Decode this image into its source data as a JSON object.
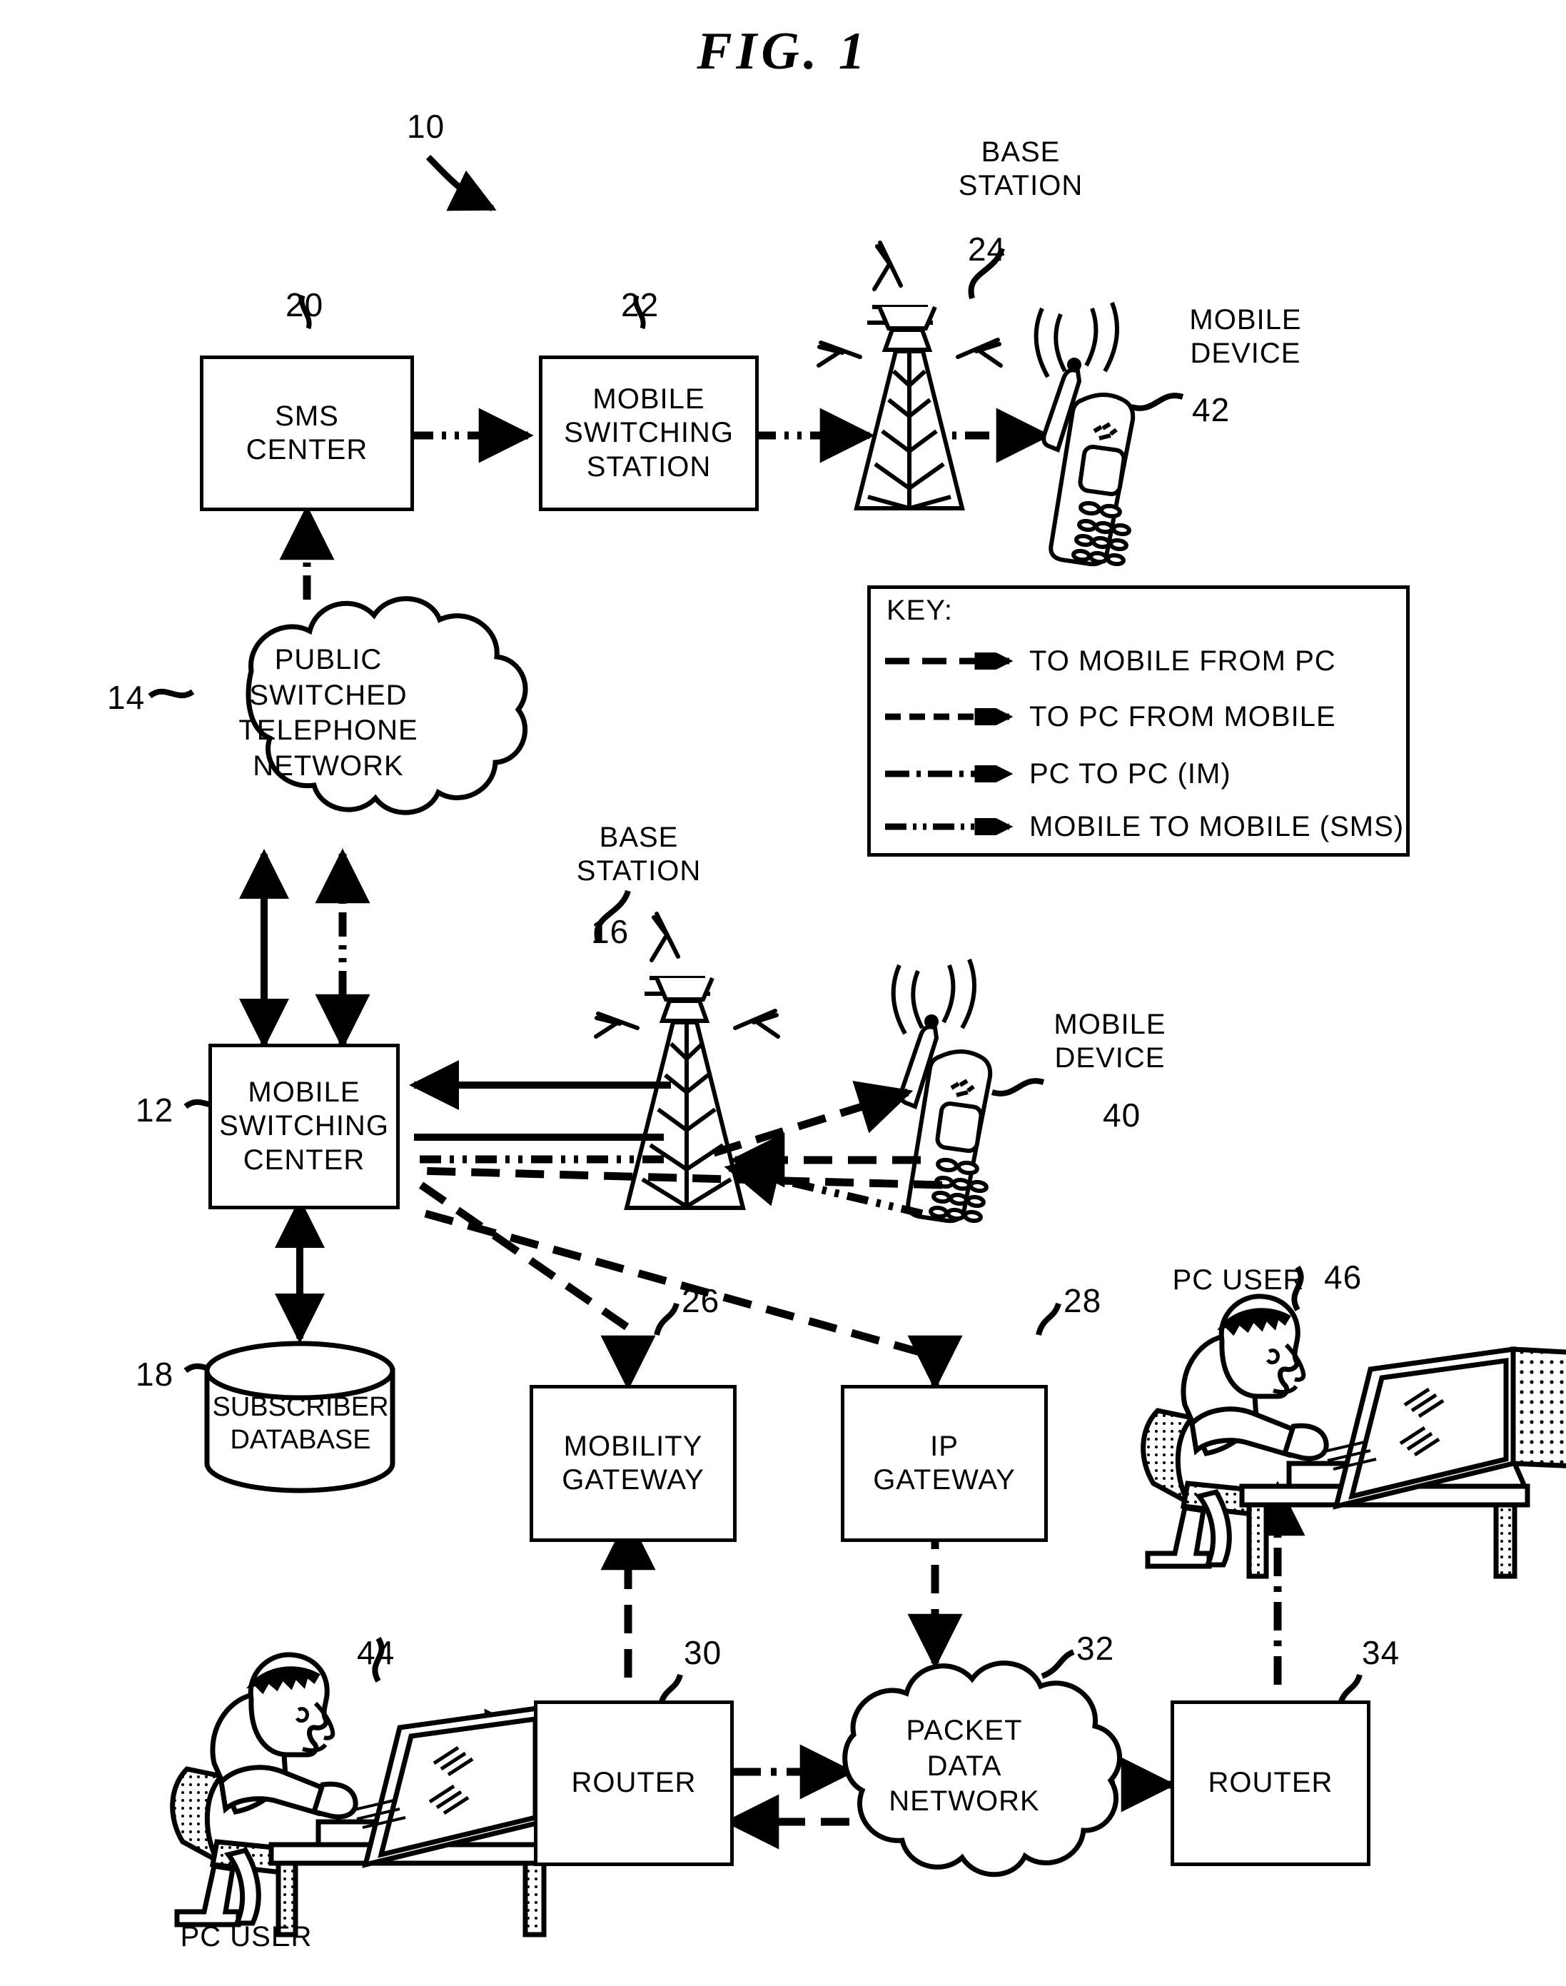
{
  "figure": {
    "title": "FIG.  1",
    "system_ref": "10"
  },
  "nodes": {
    "sms_center": {
      "label_line1": "SMS",
      "label_line2": "CENTER",
      "ref": "20"
    },
    "mobile_switching_station": {
      "label_line1": "MOBILE",
      "label_line2": "SWITCHING",
      "label_line3": "STATION",
      "ref": "22"
    },
    "base_station_top": {
      "label_line1": "BASE",
      "label_line2": "STATION",
      "ref": "24"
    },
    "mobile_device_top": {
      "label_line1": "MOBILE",
      "label_line2": "DEVICE",
      "ref": "42"
    },
    "pstn": {
      "label_line1": "PUBLIC",
      "label_line2": "SWITCHED",
      "label_line3": "TELEPHONE",
      "label_line4": "NETWORK",
      "ref": "14"
    },
    "mobile_switching_center": {
      "label_line1": "MOBILE",
      "label_line2": "SWITCHING",
      "label_line3": "CENTER",
      "ref": "12"
    },
    "subscriber_database": {
      "label_line1": "SUBSCRIBER",
      "label_line2": "DATABASE",
      "ref": "18"
    },
    "base_station_mid": {
      "label_line1": "BASE",
      "label_line2": "STATION",
      "ref": "16"
    },
    "mobile_device_mid": {
      "label_line1": "MOBILE",
      "label_line2": "DEVICE",
      "ref": "40"
    },
    "mobility_gateway": {
      "label_line1": "MOBILITY",
      "label_line2": "GATEWAY",
      "ref": "26"
    },
    "ip_gateway": {
      "label_line1": "IP",
      "label_line2": "GATEWAY",
      "ref": "28"
    },
    "pc_user_right": {
      "label": "PC USER",
      "ref": "46"
    },
    "pc_user_bottom": {
      "label": "PC USER",
      "ref": "44"
    },
    "router_left": {
      "label": "ROUTER",
      "ref": "30"
    },
    "packet_data_network": {
      "label_line1": "PACKET",
      "label_line2": "DATA",
      "label_line3": "NETWORK",
      "ref": "32"
    },
    "router_right": {
      "label": "ROUTER",
      "ref": "34"
    }
  },
  "key": {
    "title": "KEY:",
    "entries": [
      {
        "style": "long-dash",
        "label": "TO MOBILE FROM PC"
      },
      {
        "style": "short-dash",
        "label": "TO PC FROM MOBILE"
      },
      {
        "style": "dash-dot",
        "label": "PC TO PC (IM)"
      },
      {
        "style": "dash-dot-dot",
        "label": "MOBILE TO MOBILE (SMS)"
      }
    ]
  },
  "colors": {
    "ink": "#000000",
    "paper": "#ffffff"
  }
}
